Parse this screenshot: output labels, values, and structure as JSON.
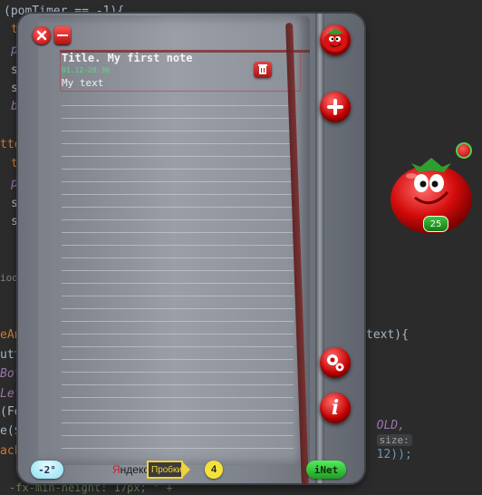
{
  "background_code": {
    "line1": "(pomTimer == -1){",
    "line2": "t",
    "line3": "p",
    "line4": "s",
    "line5": "s",
    "line6": "b",
    "line7": "tto",
    "line8": "t",
    "line9": "p",
    "line10": "s",
    "line11": "s",
    "line12": "iod",
    "line13": "eAn",
    "line14": "utt",
    "line15": "Bot",
    "line16": "Lef",
    "line17": "(Fo",
    "line18": "e($",
    "line19": "ack",
    "line20": "-fx-min-height: 17px; \" +",
    "right1": "text){",
    "right2_bold": "OLD,",
    "right2_size": "size:",
    "right2_val": "12));"
  },
  "window": {
    "close_icon": "close-icon",
    "minimize_icon": "minimize-icon"
  },
  "note": {
    "title": "Title. My first note",
    "date": "01.12-20:36",
    "text": "My text"
  },
  "sidebar": {
    "tomato_icon": "tomato-icon",
    "add_icon": "plus-icon",
    "settings_icon": "gears-icon",
    "info_icon": "info-icon",
    "info_glyph": "i"
  },
  "status_bar": {
    "temperature": "-2°",
    "yandex_first": "Я",
    "yandex_rest": "ндекс",
    "traffic_label": "Пробки",
    "traffic_score": "4",
    "inet_label": "iNet"
  },
  "pomodoro": {
    "minutes": "25"
  },
  "colors": {
    "accent_red": "#c40000",
    "green": "#1f9e22",
    "note_date": "#55e07a"
  }
}
